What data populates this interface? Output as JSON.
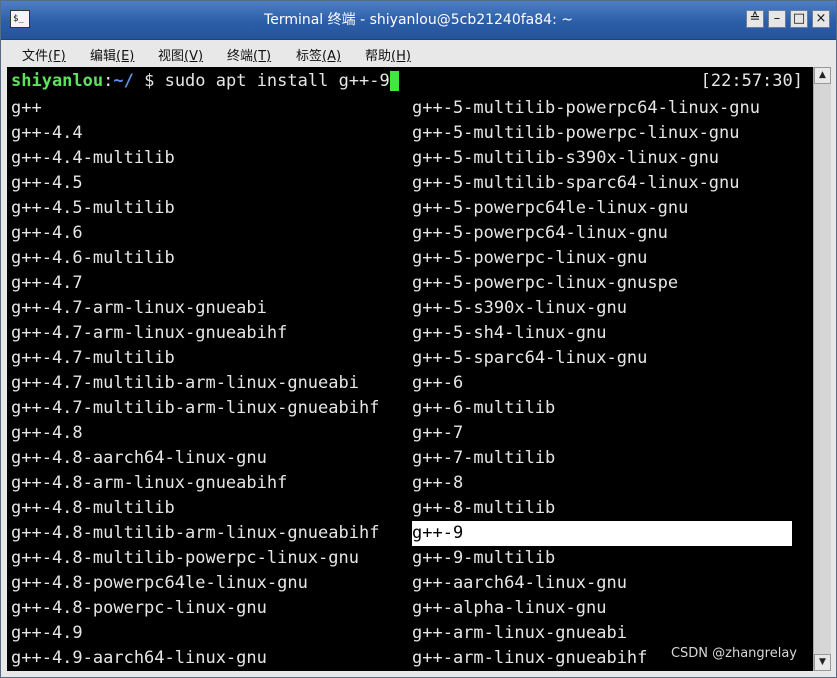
{
  "window": {
    "title": "Terminal 终端 - shiyanlou@5cb21240fa84: ~",
    "app_icon_glyph": "$_",
    "controls": {
      "shade": "≙",
      "minimize": "–",
      "maximize": "□",
      "close": "×"
    }
  },
  "menubar": {
    "items": [
      {
        "label": "文件",
        "key": "(F)"
      },
      {
        "label": "编辑",
        "key": "(E)"
      },
      {
        "label": "视图",
        "key": "(V)"
      },
      {
        "label": "终端",
        "key": "(T)"
      },
      {
        "label": "标签",
        "key": "(A)"
      },
      {
        "label": "帮助",
        "key": "(H)"
      }
    ]
  },
  "terminal": {
    "prompt_user": "shiyanlou",
    "prompt_colon": ":",
    "prompt_path": "~/",
    "prompt_dollar": " $ ",
    "command": "sudo apt install g++-9",
    "clock": "[22:57:30]",
    "left_column": [
      "g++",
      "g++-4.4",
      "g++-4.4-multilib",
      "g++-4.5",
      "g++-4.5-multilib",
      "g++-4.6",
      "g++-4.6-multilib",
      "g++-4.7",
      "g++-4.7-arm-linux-gnueabi",
      "g++-4.7-arm-linux-gnueabihf",
      "g++-4.7-multilib",
      "g++-4.7-multilib-arm-linux-gnueabi",
      "g++-4.7-multilib-arm-linux-gnueabihf",
      "g++-4.8",
      "g++-4.8-aarch64-linux-gnu",
      "g++-4.8-arm-linux-gnueabihf",
      "g++-4.8-multilib",
      "g++-4.8-multilib-arm-linux-gnueabihf",
      "g++-4.8-multilib-powerpc-linux-gnu",
      "g++-4.8-powerpc64le-linux-gnu",
      "g++-4.8-powerpc-linux-gnu",
      "g++-4.9",
      "g++-4.9-aarch64-linux-gnu"
    ],
    "right_column": [
      "g++-5-multilib-powerpc64-linux-gnu",
      "g++-5-multilib-powerpc-linux-gnu",
      "g++-5-multilib-s390x-linux-gnu",
      "g++-5-multilib-sparc64-linux-gnu",
      "g++-5-powerpc64le-linux-gnu",
      "g++-5-powerpc64-linux-gnu",
      "g++-5-powerpc-linux-gnu",
      "g++-5-powerpc-linux-gnuspe",
      "g++-5-s390x-linux-gnu",
      "g++-5-sh4-linux-gnu",
      "g++-5-sparc64-linux-gnu",
      "g++-6",
      "g++-6-multilib",
      "g++-7",
      "g++-7-multilib",
      "g++-8",
      "g++-8-multilib",
      "g++-9",
      "g++-9-multilib",
      "g++-aarch64-linux-gnu",
      "g++-alpha-linux-gnu",
      "g++-arm-linux-gnueabi",
      "g++-arm-linux-gnueabihf"
    ],
    "highlighted_entry": "g++-9"
  },
  "watermark": "CSDN @zhangrelay",
  "colors": {
    "titlebar": "#2c5ea8",
    "prompt_user": "#5fe05f",
    "prompt_path": "#5d8ff0",
    "cursor": "#3ee83e",
    "terminal_bg": "#000000",
    "highlight_bg": "#ffffff"
  }
}
